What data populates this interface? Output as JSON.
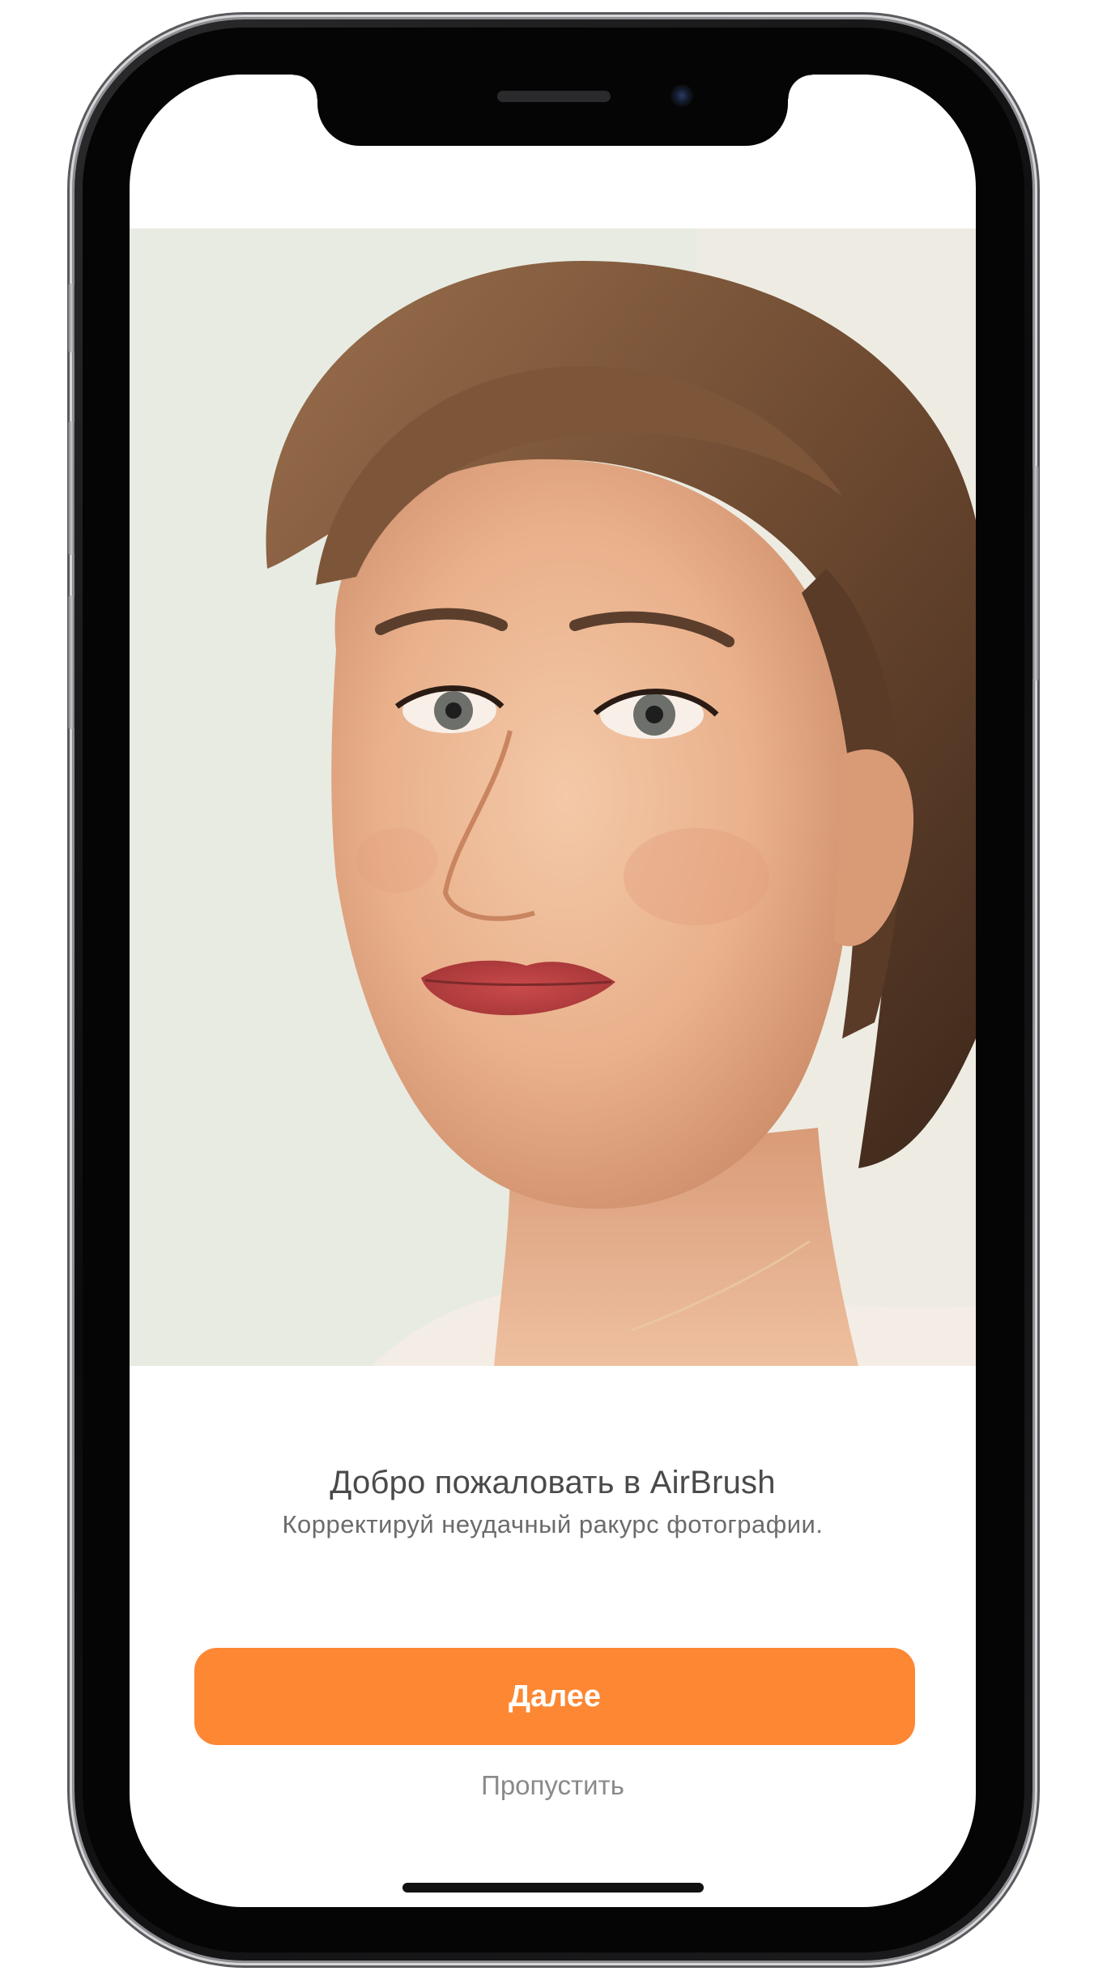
{
  "onboarding": {
    "title": "Добро пожаловать в AirBrush",
    "subtitle": "Корректируй неудачный ракурс фотографии.",
    "next_label": "Далее",
    "skip_label": "Пропустить"
  },
  "colors": {
    "accent": "#fd8733",
    "title_text": "#4a4a4a",
    "subtitle_text": "#6b6b6b",
    "skip_text": "#8a8a8a"
  },
  "icons": {
    "front_camera": "camera-icon",
    "speaker": "speaker-grille-icon"
  }
}
